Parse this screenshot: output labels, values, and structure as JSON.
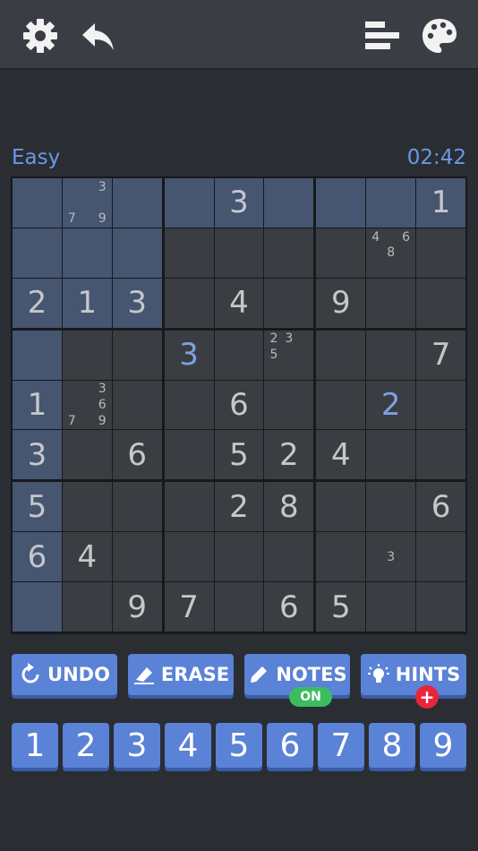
{
  "toolbar": {
    "icons": [
      "gear-icon",
      "back-arrow-icon",
      "stats-icon",
      "palette-icon"
    ]
  },
  "status": {
    "difficulty": "Easy",
    "timer": "02:42"
  },
  "board": {
    "highlight_color": "#465570",
    "cells": [
      [
        {
          "v": ""
        },
        {
          "n": [
            "",
            "",
            "3",
            "",
            "",
            "",
            "7",
            "",
            "9"
          ]
        },
        {
          "v": ""
        },
        {
          "v": ""
        },
        {
          "v": "3"
        },
        {
          "v": ""
        },
        {
          "v": ""
        },
        {
          "v": ""
        },
        {
          "v": "1"
        }
      ],
      [
        {
          "v": ""
        },
        {
          "v": ""
        },
        {
          "v": ""
        },
        {
          "v": ""
        },
        {
          "v": ""
        },
        {
          "v": ""
        },
        {
          "v": ""
        },
        {
          "n": [
            "4",
            "",
            "6",
            "",
            "8",
            "",
            "",
            "",
            ""
          ]
        },
        {
          "v": ""
        }
      ],
      [
        {
          "v": "2"
        },
        {
          "v": "1"
        },
        {
          "v": "3"
        },
        {
          "v": ""
        },
        {
          "v": "4"
        },
        {
          "v": ""
        },
        {
          "v": "9"
        },
        {
          "v": ""
        },
        {
          "v": ""
        }
      ],
      [
        {
          "v": ""
        },
        {
          "v": ""
        },
        {
          "v": ""
        },
        {
          "v": "3",
          "u": true
        },
        {
          "v": ""
        },
        {
          "n": [
            "2",
            "3",
            "",
            "5",
            "",
            "",
            "",
            "",
            ""
          ]
        },
        {
          "v": ""
        },
        {
          "v": ""
        },
        {
          "v": "7"
        }
      ],
      [
        {
          "v": "1"
        },
        {
          "n": [
            "",
            "",
            "3",
            "",
            "",
            "6",
            "7",
            "",
            "9"
          ]
        },
        {
          "v": ""
        },
        {
          "v": ""
        },
        {
          "v": "6"
        },
        {
          "v": ""
        },
        {
          "v": ""
        },
        {
          "v": "2",
          "u": true
        },
        {
          "v": ""
        }
      ],
      [
        {
          "v": "3"
        },
        {
          "v": ""
        },
        {
          "v": "6"
        },
        {
          "v": ""
        },
        {
          "v": "5"
        },
        {
          "v": "2"
        },
        {
          "v": "4"
        },
        {
          "v": ""
        },
        {
          "v": ""
        }
      ],
      [
        {
          "v": "5"
        },
        {
          "v": ""
        },
        {
          "v": ""
        },
        {
          "v": ""
        },
        {
          "v": "2"
        },
        {
          "v": "8"
        },
        {
          "v": ""
        },
        {
          "v": ""
        },
        {
          "v": "6"
        }
      ],
      [
        {
          "v": "6"
        },
        {
          "v": "4"
        },
        {
          "v": ""
        },
        {
          "v": ""
        },
        {
          "v": ""
        },
        {
          "v": ""
        },
        {
          "v": ""
        },
        {
          "n": [
            "",
            "",
            "",
            "",
            "3",
            "",
            "",
            "",
            ""
          ]
        },
        {
          "v": ""
        }
      ],
      [
        {
          "v": ""
        },
        {
          "v": ""
        },
        {
          "v": "9"
        },
        {
          "v": "7"
        },
        {
          "v": ""
        },
        {
          "v": "6"
        },
        {
          "v": "5"
        },
        {
          "v": ""
        },
        {
          "v": ""
        }
      ]
    ],
    "highlighted": [
      [
        0,
        0
      ],
      [
        0,
        1
      ],
      [
        0,
        2
      ],
      [
        0,
        3
      ],
      [
        0,
        4
      ],
      [
        0,
        5
      ],
      [
        0,
        6
      ],
      [
        0,
        7
      ],
      [
        0,
        8
      ],
      [
        1,
        0
      ],
      [
        1,
        1
      ],
      [
        1,
        2
      ],
      [
        2,
        0
      ],
      [
        2,
        1
      ],
      [
        2,
        2
      ],
      [
        3,
        0
      ],
      [
        4,
        0
      ],
      [
        5,
        0
      ],
      [
        6,
        0
      ],
      [
        7,
        0
      ],
      [
        8,
        0
      ]
    ]
  },
  "actions": {
    "undo": "UNDO",
    "erase": "ERASE",
    "notes": "NOTES",
    "notes_state": "ON",
    "hints": "HINTS",
    "hints_badge": "+"
  },
  "numpad": [
    "1",
    "2",
    "3",
    "4",
    "5",
    "6",
    "7",
    "8",
    "9"
  ]
}
